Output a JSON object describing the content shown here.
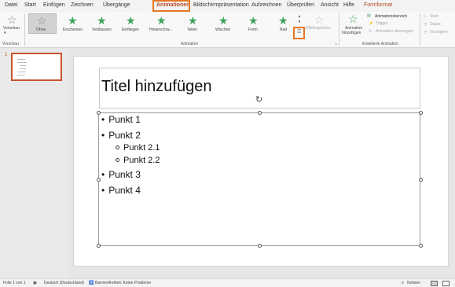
{
  "menu": {
    "tabs": [
      "Datei",
      "Start",
      "Einfügen",
      "Zeichnen",
      "Übergänge",
      "Animationen",
      "Bildschirmpräsentation",
      "Aufzeichnen",
      "Überprüfen",
      "Ansicht",
      "Hilfe",
      "Formformat"
    ],
    "active_tab": "Animationen"
  },
  "ribbon": {
    "preview": {
      "label": "Vorschau",
      "group": "Vorschau"
    },
    "animation_group": {
      "label": "Animation",
      "effects": [
        "Ohne",
        "Erscheinen",
        "Verblassen",
        "Einfliegen",
        "Hineinschw...",
        "Teilen",
        "Wischen",
        "Form",
        "Rad"
      ],
      "effect_options": "Effektoptionen"
    },
    "advanced_group": {
      "label": "Erweiterte Animation",
      "add_animation": [
        "Animation",
        "hinzufügen"
      ],
      "animation_pane": "Animationsbereich",
      "trigger": "Trigger",
      "animation_painter": "Animation übertragen"
    },
    "timing": {
      "start": "Start:",
      "duration": "Dauer:",
      "delay": "Verzögern:"
    }
  },
  "slides_pane": {
    "slide_number": "1"
  },
  "slide": {
    "title": "Titel hinzufügen",
    "bullets": [
      {
        "level": 1,
        "text": "Punkt 1"
      },
      {
        "level": 1,
        "text": "Punkt 2"
      },
      {
        "level": 2,
        "text": "Punkt 2.1"
      },
      {
        "level": 2,
        "text": "Punkt 2.2"
      },
      {
        "level": 1,
        "text": "Punkt 3"
      },
      {
        "level": 1,
        "text": "Punkt 4"
      }
    ]
  },
  "status_bar": {
    "slide_info": "Folie 1 von 1",
    "language": "Deutsch (Deutschland)",
    "accessibility": "Barrierefreiheit: Keine Probleme",
    "notes": "Notizen"
  },
  "colors": {
    "accent": "#b7472a",
    "highlight": "#e87722",
    "effect_star": "#3fa35d"
  }
}
